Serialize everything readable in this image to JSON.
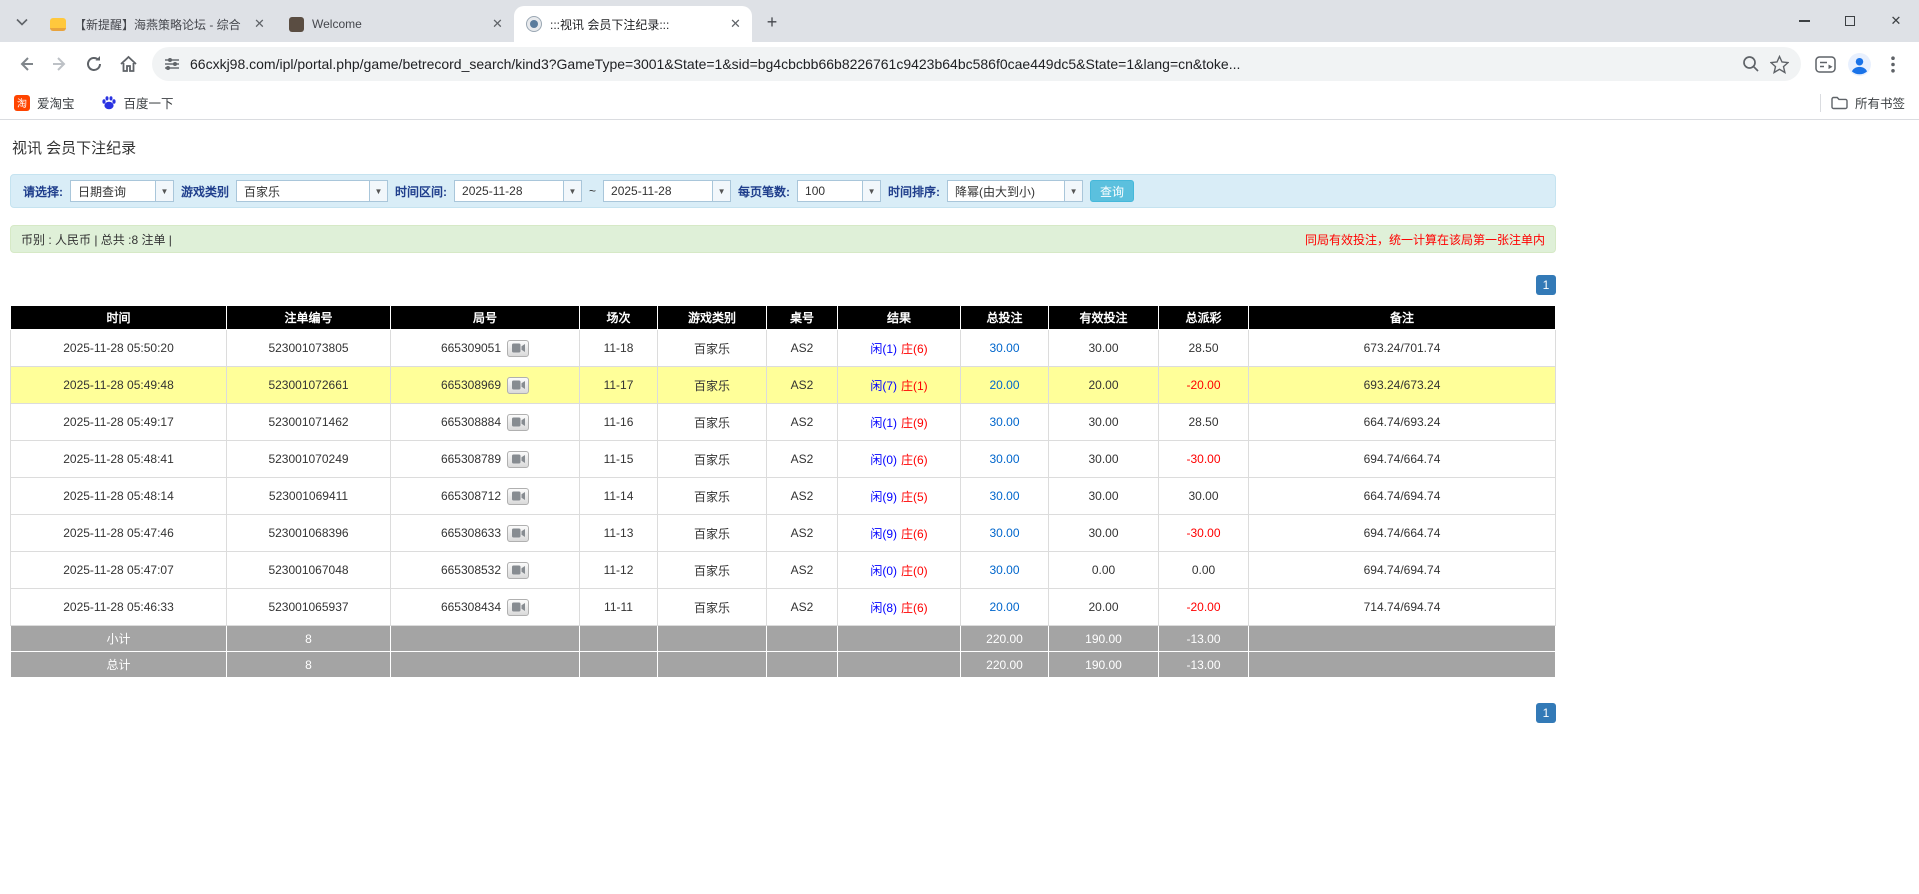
{
  "browser": {
    "tabs": [
      {
        "title": "【新提醒】海燕策略论坛 - 综合",
        "active": false
      },
      {
        "title": "Welcome",
        "active": false
      },
      {
        "title": ":::视讯 会员下注纪录:::",
        "active": true
      }
    ],
    "url": "66cxkj98.com/ipl/portal.php/game/betrecord_search/kind3?GameType=3001&State=1&sid=bg4cbcbb66b8226761c9423b64bc586f0cae449dc5&State=1&lang=cn&toke...",
    "bookmarks": [
      {
        "label": "爱淘宝"
      },
      {
        "label": "百度一下"
      }
    ],
    "all_bookmarks_label": "所有书签"
  },
  "page": {
    "title": "视讯 会员下注纪录",
    "filter": {
      "select_label": "请选择:",
      "select_value": "日期查询",
      "game_type_label": "游戏类别",
      "game_type_value": "百家乐",
      "date_range_label": "时间区间:",
      "date_from": "2025-11-28",
      "range_separator": "~",
      "date_to": "2025-11-28",
      "page_size_label": "每页笔数:",
      "page_size_value": "100",
      "sort_label": "时间排序:",
      "sort_value": "降幂(由大到小)",
      "search_button": "查询"
    },
    "summary": {
      "left": "币别 : 人民币 | 总共 :8 注单 |",
      "right": "同局有效投注，统一计算在该局第一张注单内"
    },
    "pagination": "1",
    "table": {
      "headers": [
        "时间",
        "注单编号",
        "局号",
        "场次",
        "游戏类别",
        "桌号",
        "结果",
        "总投注",
        "有效投注",
        "总派彩",
        "备注"
      ],
      "rows": [
        {
          "time": "2025-11-28 05:50:20",
          "bet_id": "523001073805",
          "round_id": "665309051",
          "session": "11-18",
          "game": "百家乐",
          "table": "AS2",
          "result_player": "闲(1)",
          "result_banker": "庄(6)",
          "total_bet": "30.00",
          "valid_bet": "30.00",
          "payout": "28.50",
          "note": "673.24/701.74",
          "highlight": false
        },
        {
          "time": "2025-11-28 05:49:48",
          "bet_id": "523001072661",
          "round_id": "665308969",
          "session": "11-17",
          "game": "百家乐",
          "table": "AS2",
          "result_player": "闲(7)",
          "result_banker": "庄(1)",
          "total_bet": "20.00",
          "valid_bet": "20.00",
          "payout": "-20.00",
          "note": "693.24/673.24",
          "highlight": true
        },
        {
          "time": "2025-11-28 05:49:17",
          "bet_id": "523001071462",
          "round_id": "665308884",
          "session": "11-16",
          "game": "百家乐",
          "table": "AS2",
          "result_player": "闲(1)",
          "result_banker": "庄(9)",
          "total_bet": "30.00",
          "valid_bet": "30.00",
          "payout": "28.50",
          "note": "664.74/693.24",
          "highlight": false
        },
        {
          "time": "2025-11-28 05:48:41",
          "bet_id": "523001070249",
          "round_id": "665308789",
          "session": "11-15",
          "game": "百家乐",
          "table": "AS2",
          "result_player": "闲(0)",
          "result_banker": "庄(6)",
          "total_bet": "30.00",
          "valid_bet": "30.00",
          "payout": "-30.00",
          "note": "694.74/664.74",
          "highlight": false
        },
        {
          "time": "2025-11-28 05:48:14",
          "bet_id": "523001069411",
          "round_id": "665308712",
          "session": "11-14",
          "game": "百家乐",
          "table": "AS2",
          "result_player": "闲(9)",
          "result_banker": "庄(5)",
          "total_bet": "30.00",
          "valid_bet": "30.00",
          "payout": "30.00",
          "note": "664.74/694.74",
          "highlight": false
        },
        {
          "time": "2025-11-28 05:47:46",
          "bet_id": "523001068396",
          "round_id": "665308633",
          "session": "11-13",
          "game": "百家乐",
          "table": "AS2",
          "result_player": "闲(9)",
          "result_banker": "庄(6)",
          "total_bet": "30.00",
          "valid_bet": "30.00",
          "payout": "-30.00",
          "note": "694.74/664.74",
          "highlight": false
        },
        {
          "time": "2025-11-28 05:47:07",
          "bet_id": "523001067048",
          "round_id": "665308532",
          "session": "11-12",
          "game": "百家乐",
          "table": "AS2",
          "result_player": "闲(0)",
          "result_banker": "庄(0)",
          "total_bet": "30.00",
          "valid_bet": "0.00",
          "payout": "0.00",
          "note": "694.74/694.74",
          "highlight": false
        },
        {
          "time": "2025-11-28 05:46:33",
          "bet_id": "523001065937",
          "round_id": "665308434",
          "session": "11-11",
          "game": "百家乐",
          "table": "AS2",
          "result_player": "闲(8)",
          "result_banker": "庄(6)",
          "total_bet": "20.00",
          "valid_bet": "20.00",
          "payout": "-20.00",
          "note": "714.74/694.74",
          "highlight": false
        }
      ],
      "footer": [
        {
          "label": "小计",
          "count": "8",
          "total_bet": "220.00",
          "valid_bet": "190.00",
          "payout": "-13.00"
        },
        {
          "label": "总计",
          "count": "8",
          "total_bet": "220.00",
          "valid_bet": "190.00",
          "payout": "-13.00"
        }
      ]
    }
  }
}
